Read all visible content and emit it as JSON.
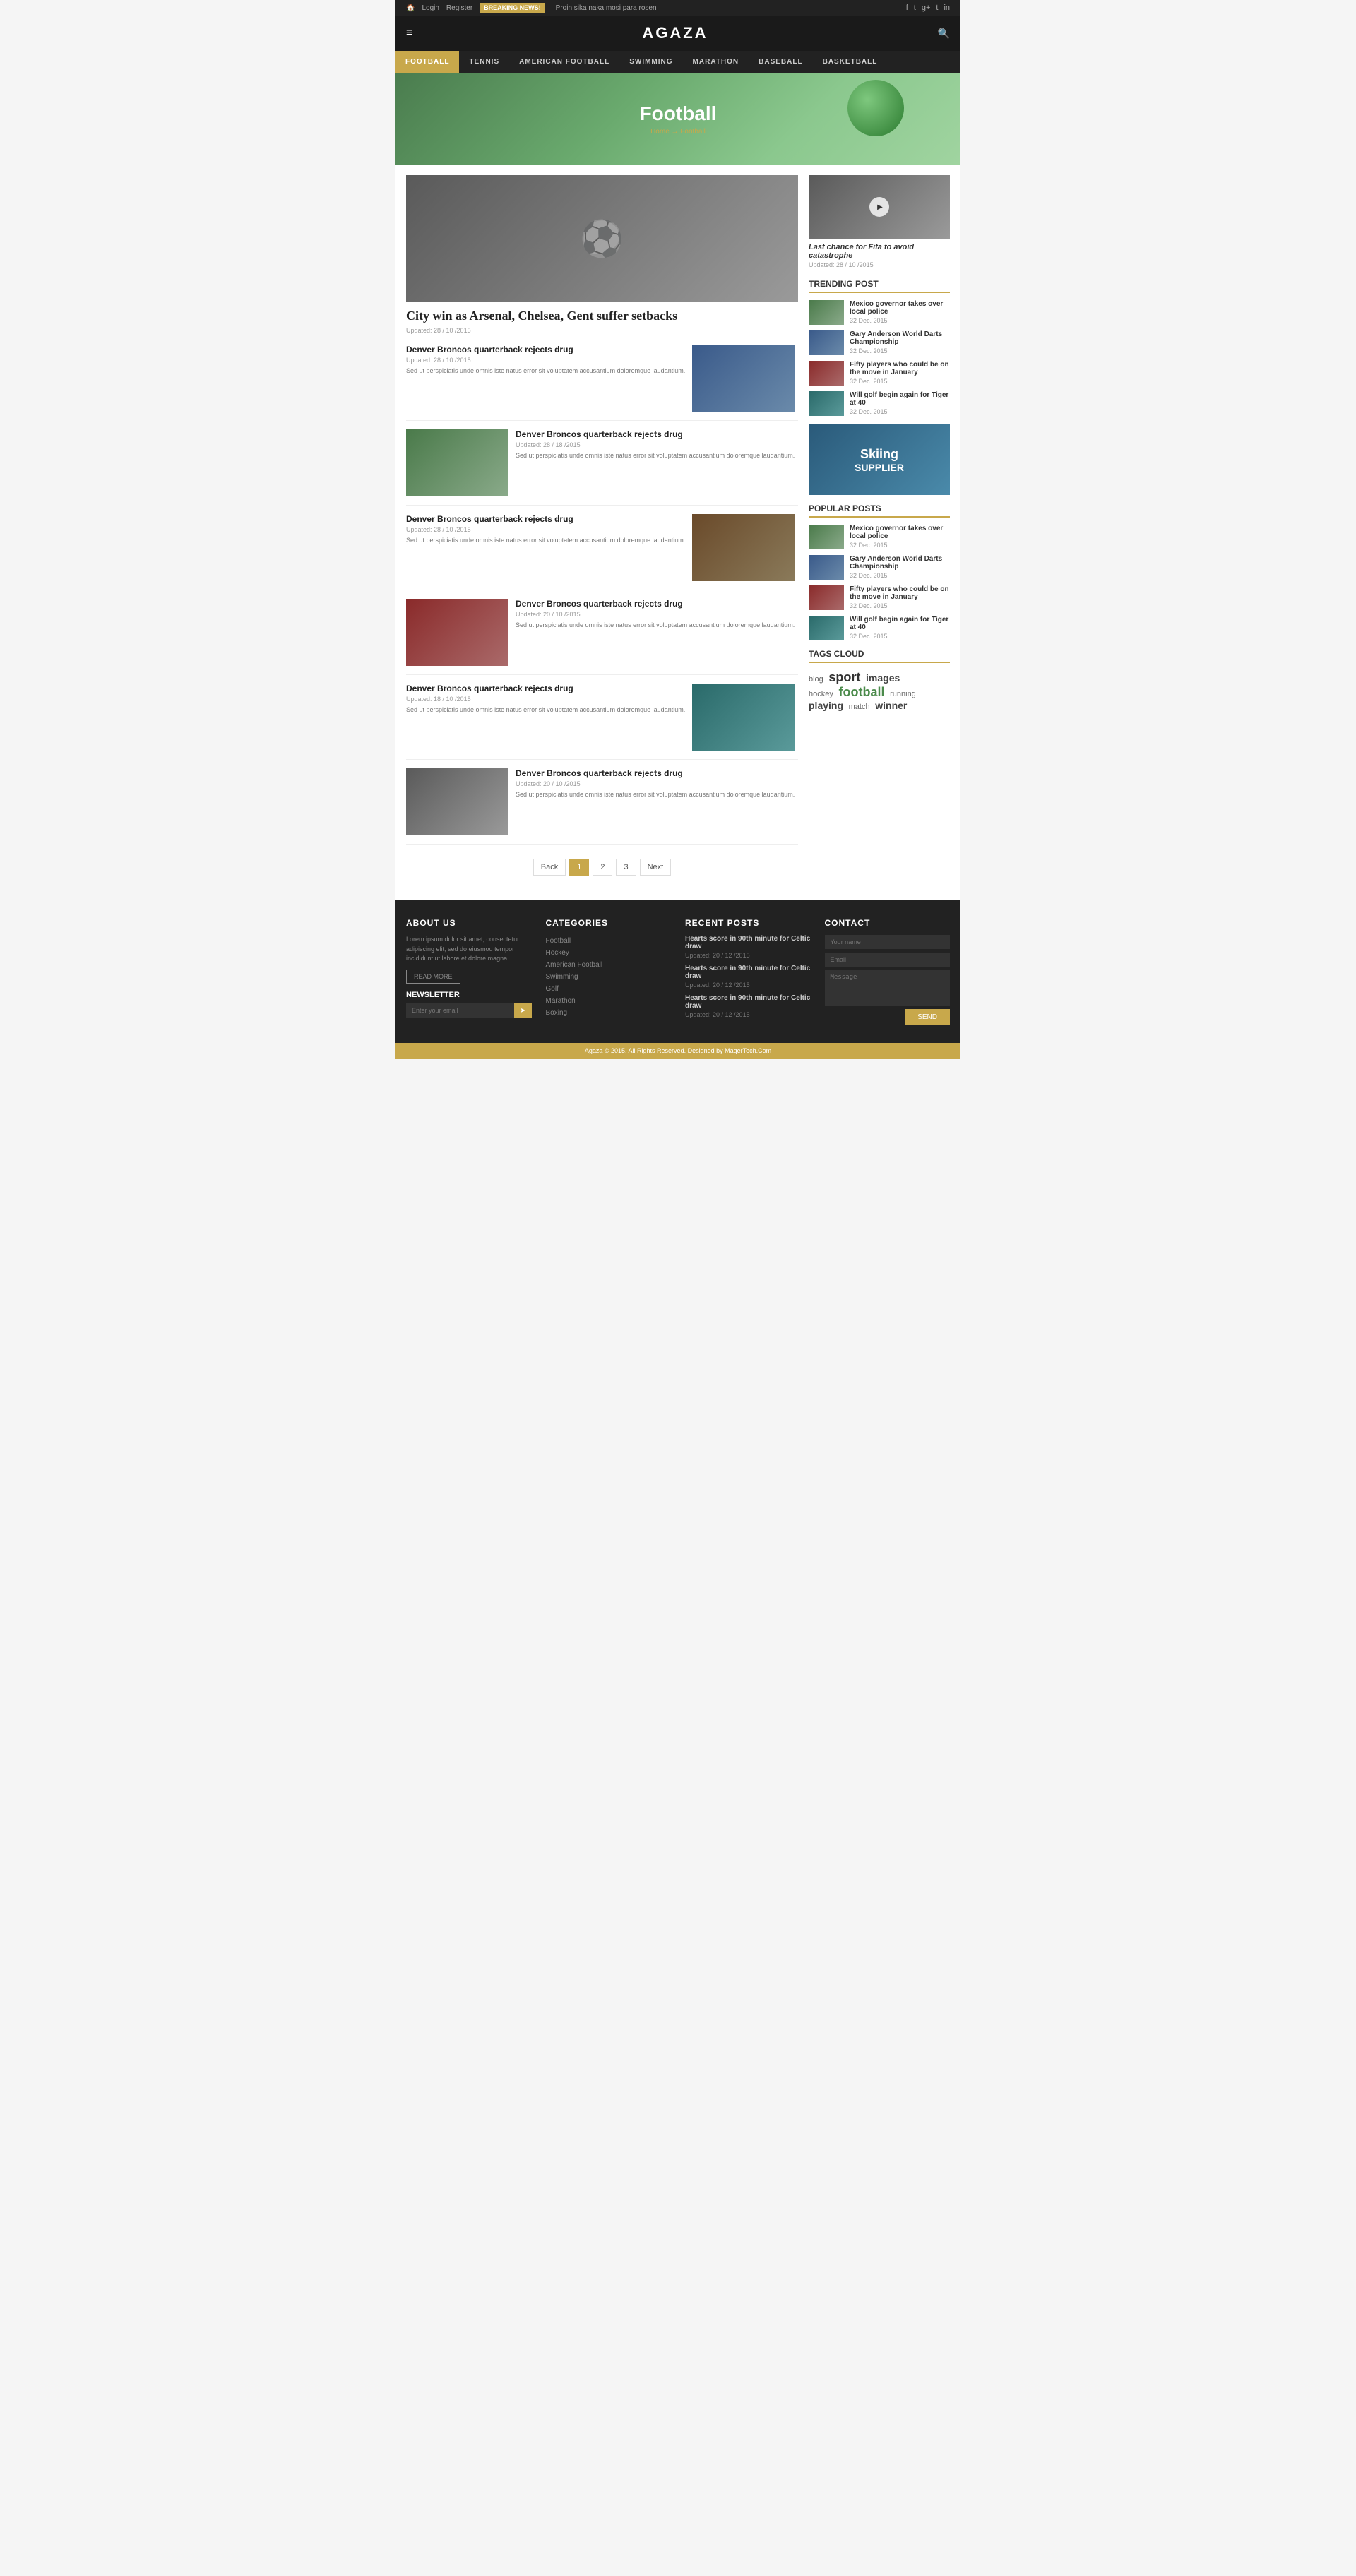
{
  "topbar": {
    "links": [
      "Home",
      "Login",
      "Register"
    ],
    "breaking_label": "BREAKING NEWS!",
    "breaking_text": "Proin sika naka mosi para rosen",
    "socials": [
      "f",
      "t",
      "g+",
      "t",
      "in"
    ]
  },
  "header": {
    "site_title": "AGAZA",
    "hamburger": "≡",
    "search_icon": "🔍"
  },
  "nav": {
    "items": [
      {
        "label": "FOOTBALL",
        "active": true
      },
      {
        "label": "TENNIS",
        "active": false
      },
      {
        "label": "AMERICAN FOOTBALL",
        "active": false
      },
      {
        "label": "SWIMMING",
        "active": false
      },
      {
        "label": "MARATHON",
        "active": false
      },
      {
        "label": "BASEBALL",
        "active": false
      },
      {
        "label": "BASKETBALL",
        "active": false
      }
    ]
  },
  "hero": {
    "title": "Football",
    "breadcrumb_home": "Home",
    "breadcrumb_sep": "→",
    "breadcrumb_current": "Football"
  },
  "featured": {
    "title": "City win as Arsenal, Chelsea, Gent suffer setbacks",
    "meta": "Updated: 28 / 10 /2015"
  },
  "sidebar_featured": {
    "title": "Last chance for Fifa to avoid catastrophe",
    "meta": "Updated: 28 / 10 /2015"
  },
  "trending": {
    "section_title": "TRENDING POST",
    "items": [
      {
        "title": "Mexico governor takes over local police",
        "date": "32 Dec. 2015"
      },
      {
        "title": "Gary Anderson World Darts Championship",
        "date": "32 Dec. 2015"
      },
      {
        "title": "Fifty players who could be on the move in January",
        "date": "32 Dec. 2015"
      },
      {
        "title": "Will golf begin again for Tiger at 40",
        "date": "32 Dec. 2015"
      }
    ]
  },
  "ad": {
    "line1": "Skiing",
    "line2": "SUPPLIER"
  },
  "popular": {
    "section_title": "POPULAR POSTS",
    "items": [
      {
        "title": "Mexico governor takes over local police",
        "date": "32 Dec. 2015"
      },
      {
        "title": "Gary Anderson World Darts Championship",
        "date": "32 Dec. 2015"
      },
      {
        "title": "Fifty players who could be on the move in January",
        "date": "32 Dec. 2015"
      },
      {
        "title": "Will golf begin again for Tiger at 40",
        "date": "32 Dec. 2015"
      }
    ]
  },
  "tags": {
    "section_title": "TAGS CLOUD",
    "items": [
      {
        "label": "blog",
        "size": "small"
      },
      {
        "label": "sport",
        "size": "large"
      },
      {
        "label": "images",
        "size": "medium"
      },
      {
        "label": "hockey",
        "size": "small"
      },
      {
        "label": "football",
        "size": "large",
        "color": "green"
      },
      {
        "label": "running",
        "size": "small"
      },
      {
        "label": "playing",
        "size": "medium"
      },
      {
        "label": "match",
        "size": "small"
      },
      {
        "label": "winner",
        "size": "medium"
      }
    ]
  },
  "articles": [
    {
      "title": "Denver Broncos quarterback rejects drug",
      "meta": "Updated: 28 / 10 /2015",
      "excerpt": "Sed ut perspiciatis unde omnis iste natus error sit voluptatem accusantium doloremque laudantium.",
      "img_class": "img-blue",
      "img_right": true
    },
    {
      "title": "Denver Broncos quarterback rejects drug",
      "meta": "Updated: 28 / 18 /2015",
      "excerpt": "Sed ut perspiciatis unde omnis iste natus error sit voluptatem accusantium doloremque laudantium.",
      "img_class": "img-green",
      "img_right": false
    },
    {
      "title": "Denver Broncos quarterback rejects drug",
      "meta": "Updated: 28 / 10 /2015",
      "excerpt": "Sed ut perspiciatis unde omnis iste natus error sit voluptatem accusantium doloremque laudantium.",
      "img_class": "img-brown",
      "img_right": true
    },
    {
      "title": "Denver Broncos quarterback rejects drug",
      "meta": "Updated: 20 / 10 /2015",
      "excerpt": "Sed ut perspiciatis unde omnis iste natus error sit voluptatem accusantium doloremque laudantium.",
      "img_class": "img-red",
      "img_right": false
    },
    {
      "title": "Denver Broncos quarterback rejects drug",
      "meta": "Updated: 18 / 10 /2015",
      "excerpt": "Sed ut perspiciatis unde omnis iste natus error sit voluptatem accusantium doloremque laudantium.",
      "img_class": "img-teal",
      "img_right": true
    },
    {
      "title": "Denver Broncos quarterback rejects drug",
      "meta": "Updated: 20 / 10 /2015",
      "excerpt": "Sed ut perspiciatis unde omnis iste natus error sit voluptatem accusantium doloremque laudantium.",
      "img_class": "img-gray",
      "img_right": false
    }
  ],
  "pagination": {
    "back_label": "Back",
    "pages": [
      "1",
      "2",
      "3"
    ],
    "next_label": "Next"
  },
  "footer": {
    "about_title": "ABOUT US",
    "about_text": "Lorem ipsum dolor sit amet, consectetur adipiscing elit, sed do eiusmod tempor incididunt ut labore et dolore magna.",
    "read_more_label": "READ MORE",
    "newsletter_title": "NEWSLETTER",
    "newsletter_placeholder": "Enter your email",
    "categories_title": "CATEGORIES",
    "categories": [
      "Football",
      "Hockey",
      "American Football",
      "Swimming",
      "Golf",
      "Marathon",
      "Boxing"
    ],
    "recent_title": "RECENT POSTS",
    "recent_posts": [
      {
        "title": "Hearts score in 90th minute for Celtic draw",
        "meta": "Updated: 20 / 12 /2015"
      },
      {
        "title": "Hearts score in 90th minute for Celtic draw",
        "meta": "Updated: 20 / 12 /2015"
      },
      {
        "title": "Hearts score in 90th minute for Celtic draw",
        "meta": "Updated: 20 / 12 /2015"
      }
    ],
    "contact_title": "CONTACT",
    "contact_name_placeholder": "Your name",
    "contact_email_placeholder": "Email",
    "contact_message_placeholder": "Message",
    "send_label": "SEND",
    "copyright": "Agaza © 2015. All Rights Reserved. Designed by MagerTech.Com"
  }
}
